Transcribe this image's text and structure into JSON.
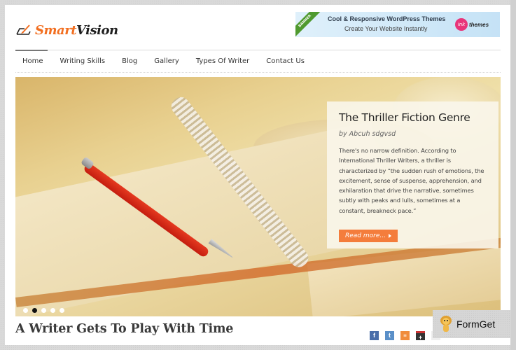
{
  "header": {
    "logo_part1": "Smart",
    "logo_part2": "Vision",
    "banner": {
      "ribbon": "BANNER",
      "line1": "Cool & Responsive WordPress Themes",
      "line2": "Create Your Website Instantly",
      "brand_mark": "ink",
      "brand_text": "themes"
    }
  },
  "nav": {
    "items": [
      {
        "label": "Home",
        "active": true
      },
      {
        "label": "Writing Skills"
      },
      {
        "label": "Blog"
      },
      {
        "label": "Gallery"
      },
      {
        "label": "Types Of Writer"
      },
      {
        "label": "Contact Us"
      }
    ]
  },
  "slider": {
    "caption": {
      "title": "The Thriller Fiction Genre",
      "byline": "by Abcuh sdgvsd",
      "body": "There's no narrow definition. According to International Thriller Writers, a thriller is characterized by “the sudden rush of emotions, the excitement, sense of suspense, apprehension, and exhilaration that drive the narrative, sometimes subtly with peaks and lulls, sometimes at a constant, breakneck pace.”",
      "button_label": "Read more..."
    },
    "dots_count": 5,
    "active_dot": 2
  },
  "post": {
    "title": "A Writer Gets To Play With Time"
  },
  "social": [
    {
      "name": "facebook",
      "glyph": "f"
    },
    {
      "name": "twitter",
      "glyph": "t"
    },
    {
      "name": "rss",
      "glyph": "≡"
    },
    {
      "name": "google-plus",
      "glyph": "+"
    },
    {
      "name": "flickr",
      "glyph": "••"
    }
  ],
  "watermark": {
    "text": "FormGet"
  },
  "colors": {
    "accent": "#f26f21",
    "button": "#f47d3c",
    "banner_ribbon": "#4f9a2f"
  }
}
